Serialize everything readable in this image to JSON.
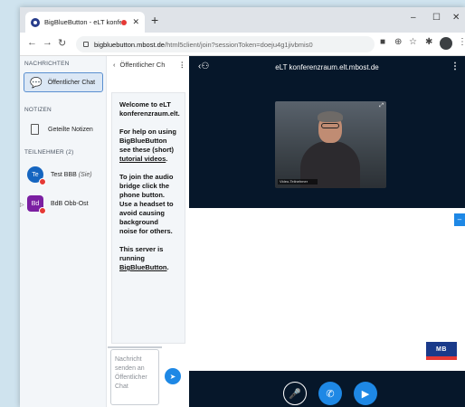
{
  "browser": {
    "tab_title": "BigBlueButton - eLT konfere",
    "tab_close": "✕",
    "new_tab": "+",
    "win_min": "–",
    "win_max": "☐",
    "win_close": "✕",
    "url_host": "bigbluebutton.mbost.de",
    "url_path": "/html5client/join?sessionToken=doeju4g1jivbmis0"
  },
  "sidebar": {
    "messages_title": "NACHRICHTEN",
    "public_chat": "Öffentlicher Chat",
    "notes_title": "NOTIZEN",
    "shared_notes": "Geteilte Notizen",
    "participants_title": "TEILNEHMER (2)",
    "participants": [
      {
        "initials": "Te",
        "name": "Test BBB",
        "you": "(Sie)",
        "color": "#1565c0"
      },
      {
        "initials": "Bd",
        "name": "BdB Obb-Ost",
        "you": "",
        "color": "#7b1fa2"
      }
    ]
  },
  "chat": {
    "header": "Öffentlicher Ch",
    "welcome_title": "Welcome to eLT konferenzraum.elt.",
    "para1_a": "For help on using BigBlueButton see these (short) ",
    "para1_link": "tutorial videos",
    "para1_b": ".",
    "para2": "To join the audio bridge click the phone button. Use a headset to avoid causing background noise for others.",
    "para3_a": "This server is running ",
    "para3_link": "BigBlueButton",
    "para3_b": ".",
    "compose_placeholder": "Nachricht senden an Öffentlicher Chat"
  },
  "meeting": {
    "title": "eLT konferenzraum.elt.mbost.de",
    "webcam_name": "Video-Teilnehmer",
    "logo_text": "MB",
    "accent": "#1e88e5",
    "background": "#06172a"
  }
}
